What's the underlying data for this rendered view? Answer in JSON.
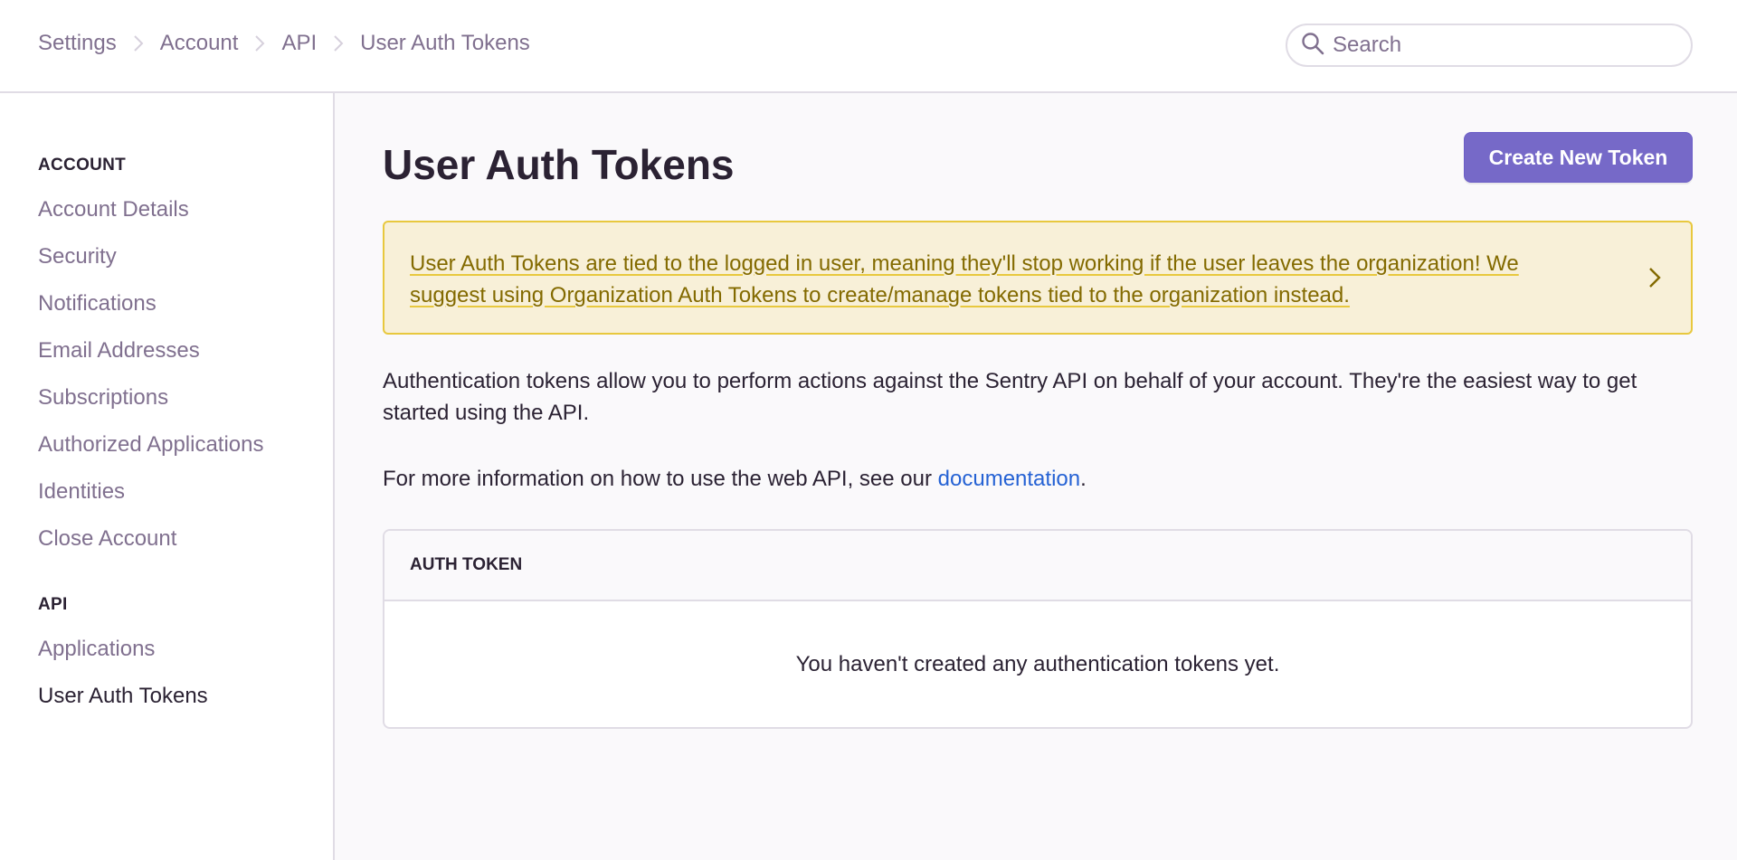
{
  "header": {
    "breadcrumb": [
      "Settings",
      "Account",
      "API",
      "User Auth Tokens"
    ],
    "search_placeholder": "Search",
    "search_value": ""
  },
  "sidebar": {
    "sections": [
      {
        "heading": "ACCOUNT",
        "items": [
          {
            "label": "Account Details",
            "active": false
          },
          {
            "label": "Security",
            "active": false
          },
          {
            "label": "Notifications",
            "active": false
          },
          {
            "label": "Email Addresses",
            "active": false
          },
          {
            "label": "Subscriptions",
            "active": false
          },
          {
            "label": "Authorized Applications",
            "active": false
          },
          {
            "label": "Identities",
            "active": false
          },
          {
            "label": "Close Account",
            "active": false
          }
        ]
      },
      {
        "heading": "API",
        "items": [
          {
            "label": "Applications",
            "active": false
          },
          {
            "label": "User Auth Tokens",
            "active": true
          }
        ]
      }
    ]
  },
  "main": {
    "title": "User Auth Tokens",
    "create_button": "Create New Token",
    "alert": "User Auth Tokens are tied to the logged in user, meaning they'll stop working if the user leaves the organization! We suggest using Organization Auth Tokens to create/manage tokens tied to the organization instead.",
    "description": "Authentication tokens allow you to perform actions against the Sentry API on behalf of your account. They're the easiest way to get started using the API.",
    "info_prefix": "For more information on how to use the web API, see our ",
    "info_link": "documentation",
    "info_suffix": ".",
    "table": {
      "header": "AUTH TOKEN",
      "empty_message": "You haven't created any authentication tokens yet."
    }
  },
  "colors": {
    "accent": "#7669c8",
    "link": "#2562d4",
    "warning_bg": "#f8f0d8",
    "warning_border": "#e8c83e",
    "warning_text": "#836a00",
    "muted_text": "#80708f",
    "text": "#2b2233"
  }
}
